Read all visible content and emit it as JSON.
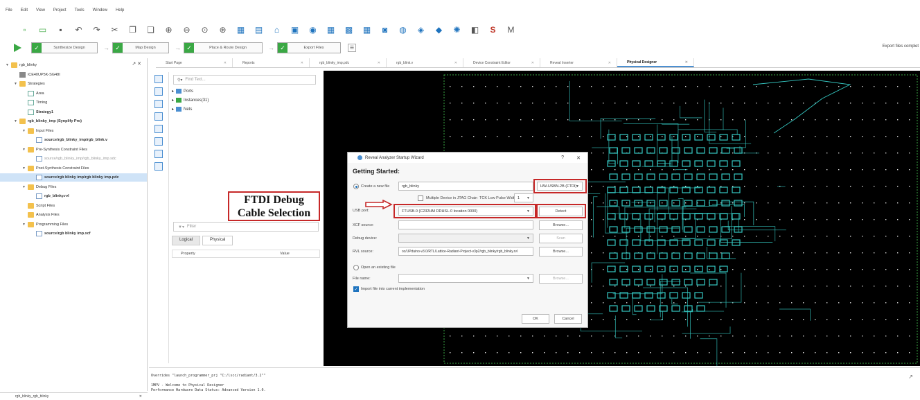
{
  "menu": [
    "File",
    "Edit",
    "View",
    "Project",
    "Tools",
    "Window",
    "Help"
  ],
  "toolbar_icons": [
    "new-icon",
    "open-icon",
    "save-icon",
    "undo-icon",
    "redo-icon",
    "cut-icon",
    "copy-icon",
    "paste-icon",
    "zoom-in-icon",
    "zoom-out-icon",
    "zoom-fit-icon",
    "zoom-area-icon",
    "netlist-icon",
    "report-icon",
    "home-icon",
    "device-icon",
    "timing-icon",
    "floorplan-icon",
    "reveal-icon",
    "physical-icon",
    "pin-icon",
    "sim-icon",
    "ip-icon",
    "program-icon",
    "gear-icon",
    "module-icon",
    "s-icon",
    "m-icon"
  ],
  "flow": {
    "steps": [
      "Synthesize Design",
      "Map Design",
      "Place & Route Design",
      "Export Files"
    ],
    "status": "Export files complet"
  },
  "tree": [
    {
      "label": "rgb_blinky",
      "level": 0,
      "icon": "folder",
      "expand": "▼"
    },
    {
      "label": "iCE40UP5K-SG48I",
      "level": 1,
      "icon": "chip",
      "expand": ""
    },
    {
      "label": "Strategies",
      "level": 1,
      "icon": "folder",
      "expand": "▼"
    },
    {
      "label": "Area",
      "level": 2,
      "icon": "strat",
      "expand": ""
    },
    {
      "label": "Timing",
      "level": 2,
      "icon": "strat",
      "expand": ""
    },
    {
      "label": "Strategy1",
      "level": 2,
      "icon": "strat",
      "expand": "",
      "bold": true
    },
    {
      "label": "rgb_blinky_imp (Synplify Pro)",
      "level": 1,
      "icon": "folder",
      "expand": "▼",
      "bold": true
    },
    {
      "label": "Input Files",
      "level": 2,
      "icon": "folder",
      "expand": "▼"
    },
    {
      "label": "source/rgb_blinky_imp/rgb_blink.v",
      "level": 3,
      "icon": "file",
      "expand": "",
      "bold": true
    },
    {
      "label": "Pre-Synthesis Constraint Files",
      "level": 2,
      "icon": "folder",
      "expand": "▼"
    },
    {
      "label": "source/rgb_blinky_imp/rgb_blinky_imp.sdc",
      "level": 3,
      "icon": "file",
      "expand": "",
      "grey": true
    },
    {
      "label": "Post-Synthesis Constraint Files",
      "level": 2,
      "icon": "folder",
      "expand": "▼"
    },
    {
      "label": "source/rgb blinky imp/rgb blinky imp.pdc",
      "level": 3,
      "icon": "file",
      "expand": "",
      "bold": true,
      "selected": true
    },
    {
      "label": "Debug Files",
      "level": 2,
      "icon": "folder",
      "expand": "▼"
    },
    {
      "label": "rgb_blinky.rvl",
      "level": 3,
      "icon": "file",
      "expand": "",
      "bold": true
    },
    {
      "label": "Script Files",
      "level": 2,
      "icon": "folder",
      "expand": ""
    },
    {
      "label": "Analysis Files",
      "level": 2,
      "icon": "folder",
      "expand": ""
    },
    {
      "label": "Programming Files",
      "level": 2,
      "icon": "folder",
      "expand": "▼"
    },
    {
      "label": "source/rgb blinky imp.xcf",
      "level": 3,
      "icon": "file",
      "expand": "",
      "bold": true
    }
  ],
  "left_bottom_tab": "rgb_blinky_rgb_blinky",
  "netlist": {
    "search_placeholder": "Find Text...",
    "items": [
      "Ports",
      "Instances(31)",
      "Nets"
    ],
    "filter_placeholder": "Filter",
    "tabs": [
      "Logical",
      "Physical"
    ],
    "columns": [
      "Property",
      "Value"
    ]
  },
  "doc_tabs": [
    {
      "label": "Start Page",
      "active": false
    },
    {
      "label": "Reports",
      "active": false
    },
    {
      "label": "rgb_blinky_imp.pdc",
      "active": false
    },
    {
      "label": "rgb_blink.v",
      "active": false
    },
    {
      "label": "Device Constraint Editor",
      "active": false
    },
    {
      "label": "Reveal Inserter",
      "active": false
    },
    {
      "label": "Physical Designer",
      "active": true
    }
  ],
  "console": [
    "Overrides \"launch_programmer_prj \"C:/lscc/radiant/3.2\"\"",
    "",
    "1MPV - Welcome to Physical Designer",
    "Performance Hardware Data Status:  Advanced       Version 1.0."
  ],
  "dialog": {
    "title": "Reveal Analyzer Startup Wizard",
    "help": "?",
    "close": "✕",
    "heading": "Getting Started:",
    "create_label": "Create a new file",
    "create_value": "rgb_blinky",
    "cable_value": "HW-USBN-2B (FTDI)",
    "multi_device_label": "Multiple Device in JTAG Chain",
    "tck_label": "TCK Low Pulse Width Delay:",
    "tck_value": "1",
    "usb_port_label": "USB port:",
    "usb_port_value": "FTUSB-0 (C232HM DDHSL-0 location 0000)",
    "detect_label": "Detect",
    "xcf_label": "XCF source:",
    "browse_label": "Browse...",
    "debug_device_label": "Debug device:",
    "scan_label": "Scan",
    "rvl_label": "RVL source:",
    "rvl_value": "oc/UPduino-v3.0/RTL/Lattice-Radiant-Project-v3p2/rgb_blinky/rgb_blinky.rvl",
    "open_existing_label": "Open an existing file",
    "file_name_label": "File name:",
    "import_label": "Import file into current implementation",
    "ok_label": "OK",
    "cancel_label": "Cancel"
  },
  "annotation": {
    "line1": "FTDI Debug",
    "line2": "Cable Selection"
  },
  "colors": {
    "accent": "#1e73be",
    "annotation_red": "#c62828",
    "route_cyan": "#35c9c3",
    "flow_green": "#3aa844"
  }
}
